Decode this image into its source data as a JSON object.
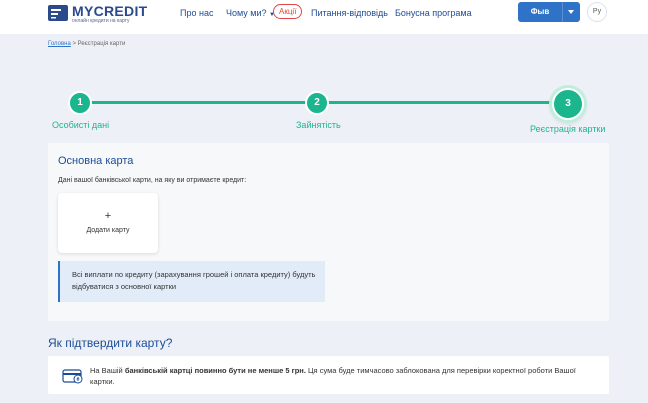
{
  "brand": {
    "name": "MYCREDIT",
    "tagline": "онлайн кредити на карту",
    "color": "#2b4a8c"
  },
  "nav": {
    "about": "Про нас",
    "why_us": "Чому ми?",
    "promo": "Акції",
    "faq": "Питання-відповідь",
    "bonus": "Бонусна програма"
  },
  "user": {
    "name": "Фыв",
    "lang": "Ру"
  },
  "breadcrumb": {
    "home": "Головна",
    "separator": ">",
    "current": "Реєстрація карти"
  },
  "stepper": {
    "accent": "#1bb68e",
    "steps": [
      {
        "number": "1",
        "label": "Особисті дані",
        "state": "done"
      },
      {
        "number": "2",
        "label": "Зайнятість",
        "state": "done"
      },
      {
        "number": "3",
        "label": "Реєстрація картки",
        "state": "active"
      }
    ]
  },
  "main_card": {
    "title": "Основна карта",
    "description": "Дані вашої банківської карти, на яку ви отримаєте кредит:",
    "add_plus": "+",
    "add_label": "Додати карту",
    "info": "Всі виплати по кредиту (зарахування грошей і оплата кредиту) будуть відбуватися з основної картки"
  },
  "verify": {
    "title": "Як підтвердити карту?",
    "text_prefix": "На Вашій ",
    "text_bold": "банківській картці повинно бути не менше 5 грн.",
    "text_suffix": " Ця сума буде тимчасово заблокована для перевірки коректної роботи Вашої картки.",
    "icon": "card-money-icon"
  }
}
